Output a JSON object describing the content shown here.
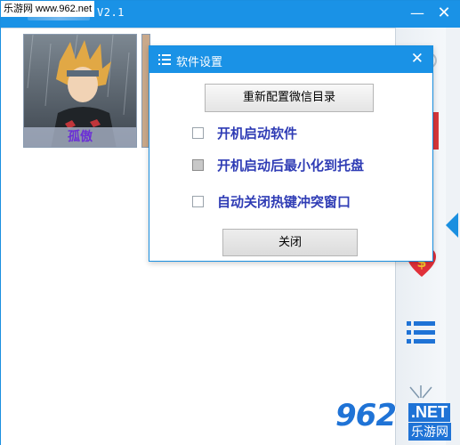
{
  "app": {
    "version": "V2.1",
    "watermark_top": "乐游网 www.962.net",
    "minimize_icon": "minimize-icon",
    "close_icon": "close-icon"
  },
  "cards": [
    {
      "label": "孤傲"
    }
  ],
  "dialog": {
    "title": "软件设置",
    "menu_icon": "list-icon",
    "reconfig_button": "重新配置微信目录",
    "options": [
      {
        "label": "开机启动软件",
        "checked": false
      },
      {
        "label": "开机启动后最小化到托盘",
        "checked": "indeterminate"
      },
      {
        "label": "自动关闭热键冲突窗口",
        "checked": false
      }
    ],
    "close_button": "关闭"
  },
  "watermark_bottom": {
    "number": "962",
    "domain": ".NET",
    "name": "乐游网"
  },
  "colors": {
    "titlebar": "#1a92e6",
    "option_text": "#2f3cb5",
    "card_label": "#6b2fd6",
    "heart": "#e0303a",
    "list_icon": "#1f73d6"
  }
}
